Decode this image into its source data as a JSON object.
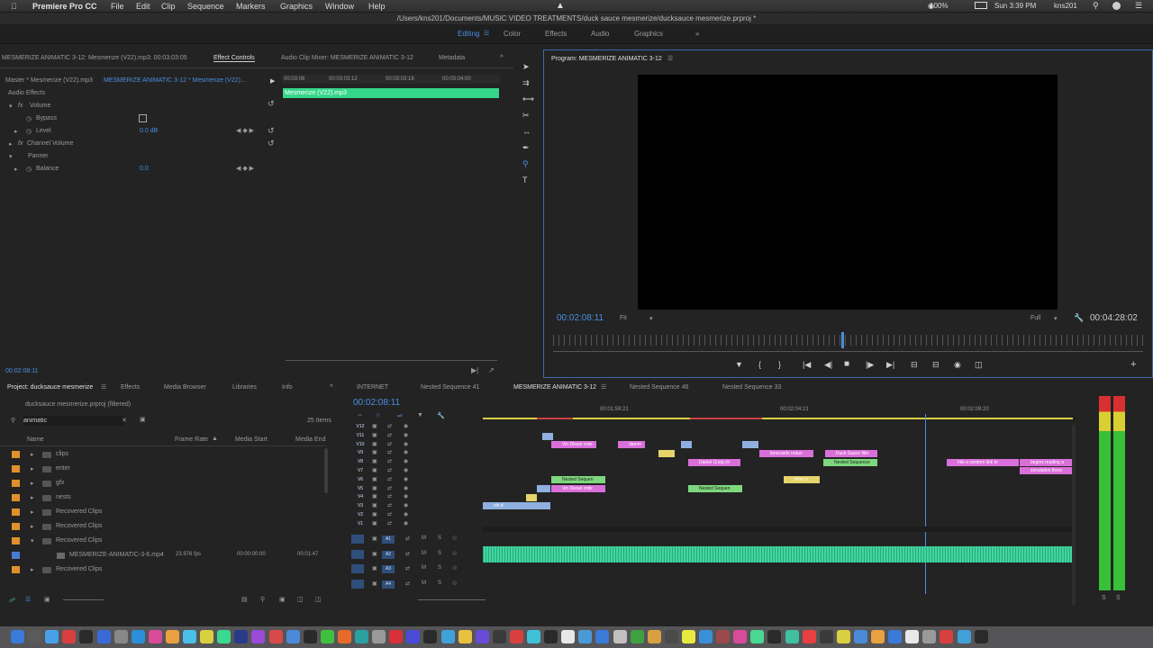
{
  "menubar": {
    "app": "Premiere Pro CC",
    "menus": [
      "File",
      "Edit",
      "Clip",
      "Sequence",
      "Markers",
      "Graphics",
      "Window",
      "Help"
    ],
    "battery": "100%",
    "clock": "Sun 3:39 PM",
    "user": "kns201"
  },
  "pathbar": {
    "path": "/Users/kns201/Documents/MUSIC VIDEO TREATMENTS/duck sauce mesmerize/ducksauce mesmerize.prproj *"
  },
  "workspaces": {
    "tabs": [
      "Editing",
      "Color",
      "Effects",
      "Audio",
      "Graphics"
    ],
    "active": "Editing"
  },
  "source": {
    "tabs": [
      "MESMERIZE ANIMATIC 3-12: Mesmerize (V22).mp3: 00:03:03:05",
      "Effect Controls",
      "Audio Clip Mixer: MESMERIZE ANIMATIC 3-12",
      "Metadata"
    ],
    "master": "Master * Mesmerize (V22).mp3",
    "sequence": "MESMERIZE ANIMATIC 3-12 * Mesmerize (V22)...",
    "ruler": [
      "00:03:06",
      "00:03:03:12",
      "00:03:03:18",
      "00:03:04:00"
    ],
    "clip_name": "Mesmerize (V22).mp3",
    "section": "Audio Effects",
    "effects": [
      {
        "name": "Volume",
        "indent": 0
      },
      {
        "name": "Bypass",
        "indent": 1
      },
      {
        "name": "Level",
        "indent": 1,
        "value": "0.0 dB"
      },
      {
        "name": "Channel Volume",
        "indent": 0
      },
      {
        "name": "Panner",
        "indent": 0
      },
      {
        "name": "Balance",
        "indent": 1,
        "value": "0.0"
      }
    ],
    "timecode": "00:02:08:11"
  },
  "program": {
    "title": "Program: MESMERIZE ANIMATIC 3-12",
    "timecode": "00:02:08:11",
    "fit": "Fit",
    "quality": "Full",
    "duration": "00:04:28:02"
  },
  "project": {
    "tabs": [
      "Project: ducksauce mesmerize",
      "Effects",
      "Media Browser",
      "Libraries",
      "Info"
    ],
    "file": "ducksauce mesmerize.prproj (filtered)",
    "search": "animatic",
    "count": "25 Items",
    "columns": [
      "Name",
      "Frame Rate",
      "Media Start",
      "Media End"
    ],
    "items": [
      {
        "name": "clips",
        "type": "folder"
      },
      {
        "name": "enter",
        "type": "folder"
      },
      {
        "name": "gfx",
        "type": "folder"
      },
      {
        "name": "nests",
        "type": "folder"
      },
      {
        "name": "Recovered Clips",
        "type": "folder"
      },
      {
        "name": "Recovered Clips",
        "type": "folder"
      },
      {
        "name": "Recovered Clips",
        "type": "folder"
      },
      {
        "name": "MESMERIZE-ANIMATIC-3-6.mp4",
        "type": "clip",
        "fps": "23.976 fps",
        "start": "00:00:00:00",
        "end": "00:01:47"
      },
      {
        "name": "Recovered Clips",
        "type": "folder"
      }
    ]
  },
  "timeline": {
    "tabs": [
      "INTERNET",
      "Nested Sequence 41",
      "MESMERIZE ANIMATIC 3-12",
      "Nested Sequence 46",
      "Nested Sequence 33"
    ],
    "active": "MESMERIZE ANIMATIC 3-12",
    "timecode": "00:02:08:11",
    "ruler": [
      "00:01:59:21",
      "00:02:04:21",
      "00:02:09:20"
    ],
    "video_tracks": [
      "V12",
      "V11",
      "V10",
      "V9",
      "V8",
      "V7",
      "V6",
      "V5",
      "V4",
      "V3",
      "V2",
      "V1"
    ],
    "audio_tracks": [
      "A1",
      "A2",
      "A3",
      "A4"
    ],
    "clips": [
      "Vin Diesel orde",
      "damm",
      "timecards redux",
      "Duck Sauce film",
      "Daniel Craig ch",
      "Nested Sequence",
      "hits a random link to",
      "begins reading a",
      "simulation theor",
      "Nested Sequen",
      "Vin Diesel orde",
      "Nested Sequen",
      "time cr",
      "vin d"
    ]
  },
  "meter": {
    "labels": [
      "S",
      "S"
    ]
  }
}
